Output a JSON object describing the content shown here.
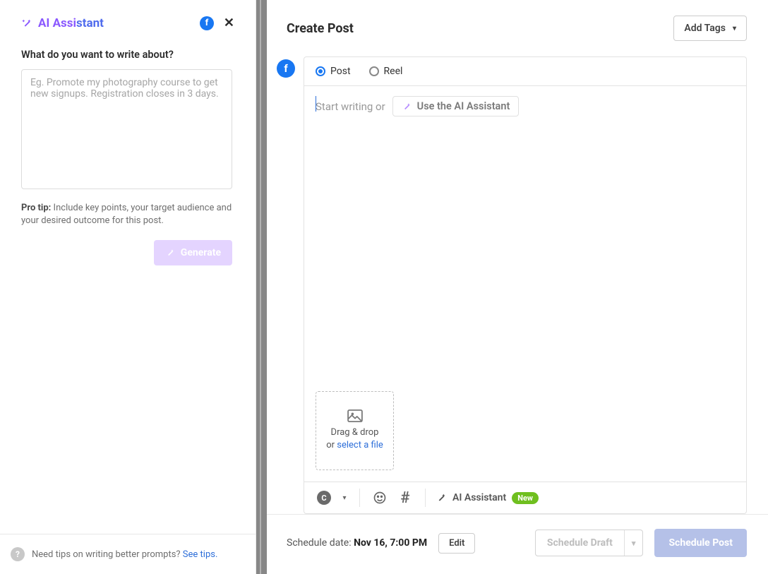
{
  "ai_panel": {
    "title_a": "AI Assi",
    "title_b": "stant",
    "question": "What do you want to write about?",
    "placeholder": "Eg. Promote my photography course to get new signups. Registration closes in 3 days.",
    "tip_label": "Pro tip:",
    "tip_text": " Include key points, your target audience and your desired outcome for this post.",
    "generate_label": "Generate",
    "footer_text": "Need tips on writing better prompts? ",
    "footer_link": "See tips."
  },
  "composer": {
    "title": "Create Post",
    "add_tags": "Add Tags",
    "post_label": "Post",
    "reel_label": "Reel",
    "placeholder_lead": "Start writing or",
    "ai_button": "Use the AI Assistant",
    "drop_line1": "Drag & drop",
    "drop_line2_pre": "or ",
    "drop_line2_link": "select a file",
    "toolbar_ai": "AI Assistant",
    "toolbar_new": "New"
  },
  "footer": {
    "sched_pre": "Schedule date: ",
    "sched_val": "Nov 16, 7:00 PM",
    "edit": "Edit",
    "draft": "Schedule Draft",
    "schedule": "Schedule Post"
  }
}
